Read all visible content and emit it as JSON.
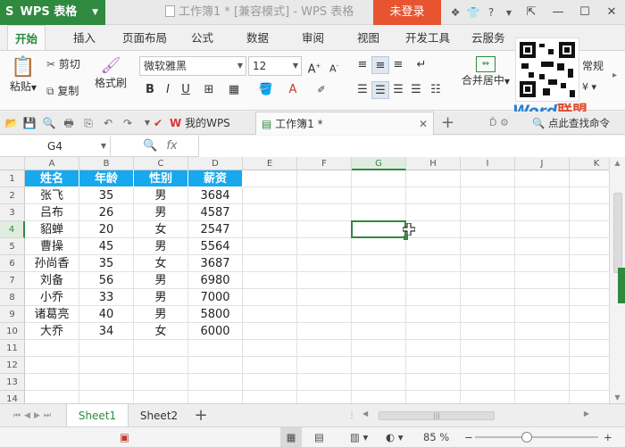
{
  "titlebar": {
    "app_name": "WPS 表格",
    "window_title": "工作簿1 * [兼容模式] - WPS 表格",
    "login_label": "未登录"
  },
  "ribbon_tabs": [
    "开始",
    "插入",
    "页面布局",
    "公式",
    "数据",
    "审阅",
    "视图",
    "开发工具",
    "云服务"
  ],
  "ribbon": {
    "paste_label": "粘贴",
    "cut_label": "剪切",
    "copy_label": "复制",
    "format_painter_label": "格式刷",
    "font_name": "微软雅黑",
    "font_size": "12",
    "merge_center_label": "合并居中",
    "number_format": "常规"
  },
  "watermark": {
    "word": "Word",
    "lianmeng": "联盟"
  },
  "doc_tabs": {
    "my_wps": "我的WPS",
    "workbook": "工作簿1 *",
    "search_hint": "点此查找命令"
  },
  "formula_bar": {
    "cell_ref": "G4",
    "fx": "fx",
    "content": ""
  },
  "columns": [
    "A",
    "B",
    "C",
    "D",
    "E",
    "F",
    "G",
    "H",
    "I",
    "J",
    "K"
  ],
  "rows": [
    "1",
    "2",
    "3",
    "4",
    "5",
    "6",
    "7",
    "8",
    "9",
    "10",
    "11",
    "12",
    "13",
    "14"
  ],
  "table": {
    "headers": [
      "姓名",
      "年龄",
      "性别",
      "薪资"
    ],
    "rows": [
      [
        "张飞",
        "35",
        "男",
        "3684"
      ],
      [
        "吕布",
        "26",
        "男",
        "4587"
      ],
      [
        "貂蝉",
        "20",
        "女",
        "2547"
      ],
      [
        "曹操",
        "45",
        "男",
        "5564"
      ],
      [
        "孙尚香",
        "35",
        "女",
        "3687"
      ],
      [
        "刘备",
        "56",
        "男",
        "6980"
      ],
      [
        "小乔",
        "33",
        "男",
        "7000"
      ],
      [
        "诸葛亮",
        "40",
        "男",
        "5800"
      ],
      [
        "大乔",
        "34",
        "女",
        "6000"
      ]
    ]
  },
  "selected_cell": "G4",
  "sheets": [
    "Sheet1",
    "Sheet2"
  ],
  "active_sheet": "Sheet1",
  "status": {
    "zoom": "85 %"
  },
  "colors": {
    "accent_green": "#2f8a3f",
    "header_blue": "#17a8ee",
    "login_orange": "#e8542f"
  }
}
